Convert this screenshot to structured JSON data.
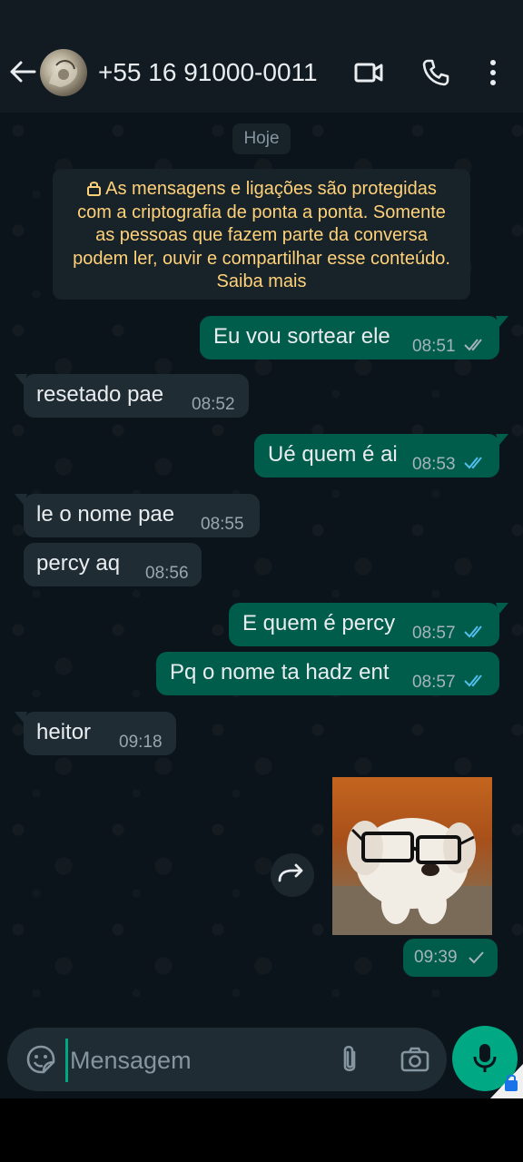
{
  "header": {
    "contact_name": "+55 16 91000-0011"
  },
  "chat": {
    "date_chip": "Hoje",
    "e2e_notice": {
      "line1": "As mensagens e ligações são protegidas",
      "line2": "com a criptografia de ponta a ponta. Somente",
      "line3": "as pessoas que fazem parte da conversa",
      "line4": "podem ler, ouvir e compartilhar esse conteúdo.",
      "line5": "Saiba mais"
    },
    "messages": [
      {
        "direction": "out",
        "text": "Eu vou sortear ele",
        "time": "08:51",
        "status": "delivered"
      },
      {
        "direction": "in",
        "text": "resetado pae",
        "time": "08:52"
      },
      {
        "direction": "out",
        "text": "Ué quem é ai",
        "time": "08:53",
        "status": "read"
      },
      {
        "direction": "in",
        "text": "le o nome pae",
        "time": "08:55"
      },
      {
        "direction": "in",
        "text": "percy aq",
        "time": "08:56"
      },
      {
        "direction": "out",
        "text": "E quem é percy",
        "time": "08:57",
        "status": "read"
      },
      {
        "direction": "out",
        "text": "Pq o nome ta hadz ent",
        "time": "08:57",
        "status": "read"
      },
      {
        "direction": "in",
        "text": "heitor",
        "time": "09:18"
      }
    ],
    "sticker": {
      "description_icon": "dog-with-glasses-sticker",
      "time": "09:39",
      "status": "sent"
    }
  },
  "input": {
    "placeholder": "Mensagem"
  },
  "colors": {
    "outgoing_bubble": "#005c4b",
    "incoming_bubble": "#202c33",
    "accent": "#00a884",
    "read_tick": "#53bdeb",
    "notice_text": "#ffd279"
  }
}
